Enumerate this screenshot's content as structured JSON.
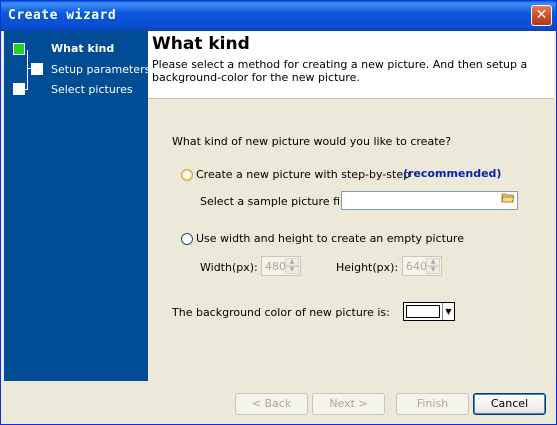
{
  "window": {
    "title": "Create wizard",
    "close_label": "✕"
  },
  "sidebar": {
    "steps": [
      {
        "label": "What kind"
      },
      {
        "label": "Setup parameters"
      },
      {
        "label": "Select pictures"
      }
    ],
    "active_step": 0
  },
  "header": {
    "title": "What kind",
    "description": "Please select a method for creating a new picture. And then setup a background-color for the new picture."
  },
  "main": {
    "question": "What kind of new picture would you like to create?",
    "option_step_by_step": {
      "label": "Create a new picture with step-by-step",
      "badge": "(recommended)",
      "checked": true,
      "sample_label": "Select a sample picture first:",
      "sample_value": "",
      "browse_icon": "folder-open-icon"
    },
    "option_empty": {
      "label": "Use width and height to create an empty picture",
      "checked": false,
      "width_label": "Width(px):",
      "width_value": "480",
      "height_label": "Height(px):",
      "height_value": "640"
    },
    "background": {
      "label": "The background color of new picture is:",
      "color": "#FFFFFF"
    }
  },
  "footer": {
    "back_label": "< Back",
    "next_label": "Next >",
    "finish_label": "Finish",
    "cancel_label": "Cancel"
  },
  "colors": {
    "sidebar_bg": "#004D95",
    "active_step": "#22D322",
    "recommended": "#0A22B0",
    "titlebar": "#0A55DC"
  }
}
